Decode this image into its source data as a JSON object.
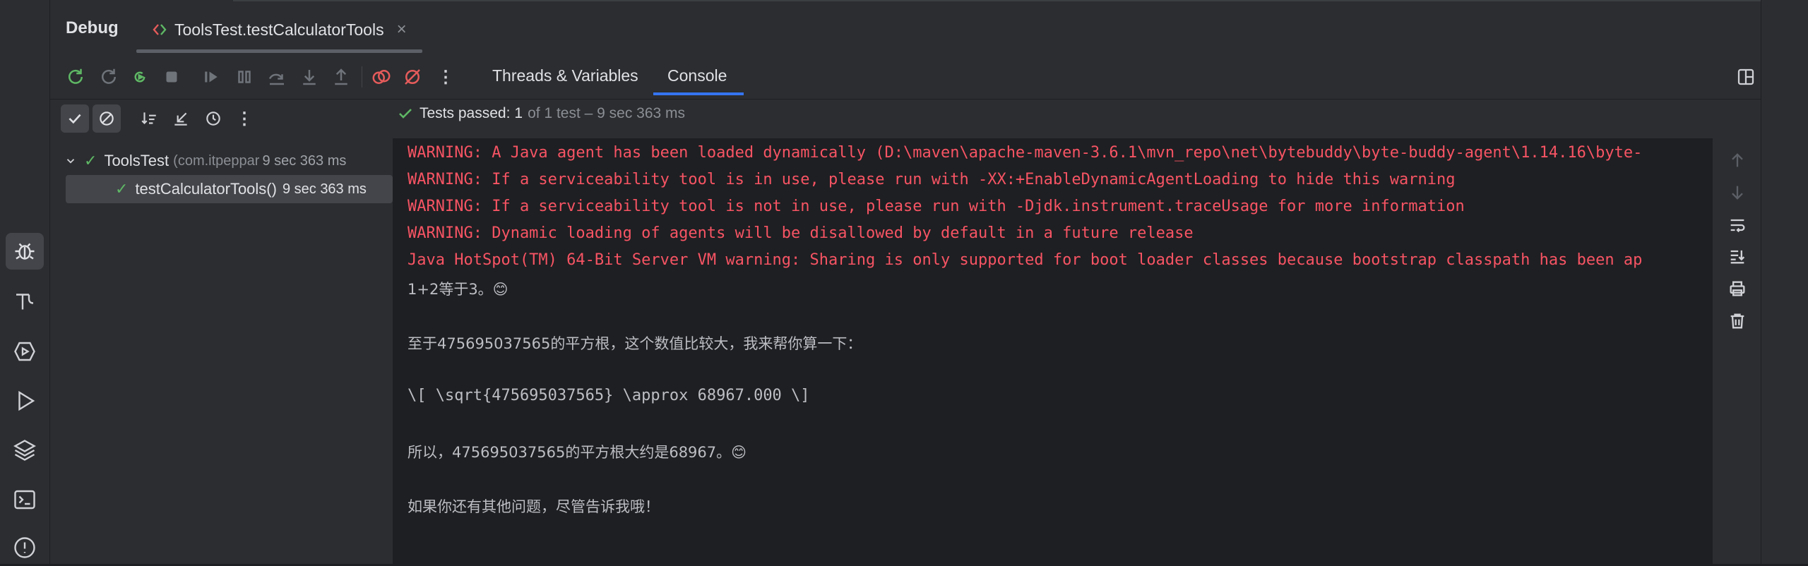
{
  "header": {
    "title": "Debug",
    "tab_label": "ToolsTest.testCalculatorTools",
    "tab_close": "×"
  },
  "toolbar": {
    "threads_label": "Threads & Variables",
    "console_label": "Console",
    "more_label": "⋮"
  },
  "status": {
    "passed_label": "Tests passed:",
    "passed_count": "1",
    "passed_rest": "of 1 test – 9 sec 363 ms"
  },
  "tree": {
    "root": {
      "name": "ToolsTest",
      "pkg": "(com.itpeppar",
      "time": "9 sec 363 ms"
    },
    "child": {
      "name": "testCalculatorTools()",
      "time": "9 sec 363 ms"
    }
  },
  "console": {
    "lines": [
      "WARNING: A Java agent has been loaded dynamically (D:\\maven\\apache-maven-3.6.1\\mvn_repo\\net\\bytebuddy\\byte-buddy-agent\\1.14.16\\byte-",
      "WARNING: If a serviceability tool is in use, please run with -XX:+EnableDynamicAgentLoading to hide this warning",
      "WARNING: If a serviceability tool is not in use, please run with -Djdk.instrument.traceUsage for more information",
      "WARNING: Dynamic loading of agents will be disallowed by default in a future release",
      "Java HotSpot(TM) 64-Bit Server VM warning: Sharing is only supported for boot loader classes because bootstrap classpath has been ap",
      "1+2等于3。😊",
      "至于475695037565的平方根，这个数值比较大，我来帮你算一下：",
      "\\[ \\sqrt{475695037565} \\approx 68967.000 \\]",
      "所以，475695037565的平方根大约是68967。😊",
      "如果你还有其他问题，尽管告诉我哦！"
    ]
  },
  "colors": {
    "error": "#f75464",
    "output": "#bcbec4",
    "pass": "#5fb865",
    "accent": "#3574f0"
  }
}
